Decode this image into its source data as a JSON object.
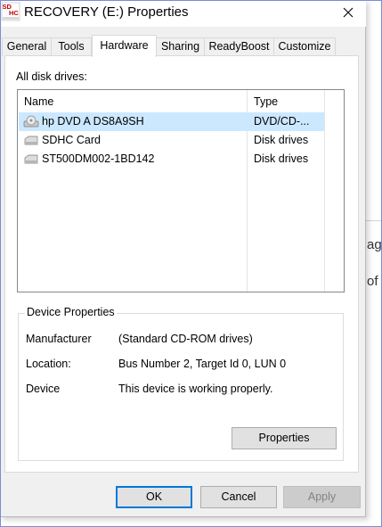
{
  "window": {
    "title": "RECOVERY (E:) Properties",
    "icon_text_top": "SD",
    "icon_text_bottom": "HC"
  },
  "background_window": {
    "fragment_1": "age",
    "fragment_2": "of"
  },
  "tabs": [
    {
      "label": "General",
      "active": false
    },
    {
      "label": "Tools",
      "active": false
    },
    {
      "label": "Hardware",
      "active": true
    },
    {
      "label": "Sharing",
      "active": false
    },
    {
      "label": "ReadyBoost",
      "active": false
    },
    {
      "label": "Customize",
      "active": false
    }
  ],
  "hardware": {
    "drives_label": "All disk drives:",
    "columns": {
      "name": "Name",
      "type": "Type"
    },
    "drives": [
      {
        "name": "hp DVD A  DS8A9SH",
        "type": "DVD/CD-...",
        "icon": "dvd-drive-icon",
        "selected": true
      },
      {
        "name": "SDHC Card",
        "type": "Disk drives",
        "icon": "disk-drive-icon",
        "selected": false
      },
      {
        "name": "ST500DM002-1BD142",
        "type": "Disk drives",
        "icon": "disk-drive-icon",
        "selected": false
      }
    ],
    "device_properties": {
      "title": "Device Properties",
      "manufacturer_label": "Manufacturer",
      "manufacturer_value": "(Standard CD-ROM drives)",
      "location_label": "Location:",
      "location_value": "Bus Number 2, Target Id 0, LUN 0",
      "status_label": "Device",
      "status_value": "This device is working properly.",
      "properties_button": "Properties"
    }
  },
  "buttons": {
    "ok": "OK",
    "cancel": "Cancel",
    "apply": "Apply"
  },
  "colors": {
    "selection": "#cce8ff",
    "default_button_border": "#0078d7",
    "frame": "#7a8ed6"
  }
}
